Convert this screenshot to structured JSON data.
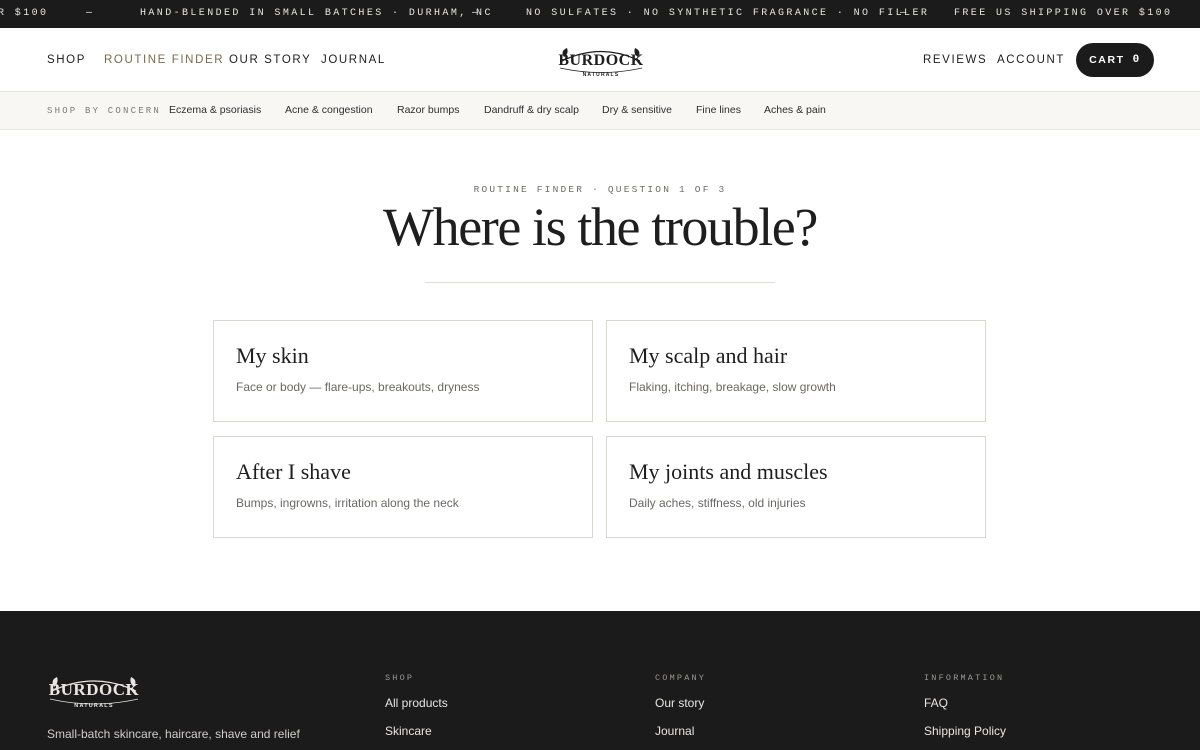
{
  "ticker": {
    "items": [
      "R $100",
      "—",
      "HAND-BLENDED IN SMALL BATCHES · DURHAM, NC",
      "—",
      "NO SULFATES · NO SYNTHETIC FRAGRANCE · NO FILLER",
      "—",
      "FREE US SHIPPING OVER $100"
    ]
  },
  "header": {
    "nav_left": [
      "SHOP",
      "ROUTINE FINDER",
      "OUR STORY",
      "JOURNAL"
    ],
    "logo": {
      "wordmark": "BURDOCK",
      "sub": "NATURALS"
    },
    "nav_right": [
      "REVIEWS",
      "ACCOUNT"
    ],
    "cart": {
      "label": "CART",
      "count": "0"
    },
    "accent_color": "#7a6a4a"
  },
  "concern_bar": {
    "label": "SHOP BY CONCERN",
    "items": [
      "Eczema & psoriasis",
      "Acne & congestion",
      "Razor bumps",
      "Dandruff & dry scalp",
      "Dry & sensitive",
      "Fine lines",
      "Aches & pain"
    ]
  },
  "finder": {
    "eyebrow": "ROUTINE FINDER · QUESTION 1 OF 3",
    "question": "Where is the trouble?",
    "options": [
      {
        "title": "My skin",
        "desc": "Face or body — flare-ups, breakouts, dryness"
      },
      {
        "title": "My scalp and hair",
        "desc": "Flaking, itching, breakage, slow growth"
      },
      {
        "title": "After I shave",
        "desc": "Bumps, ingrowns, irritation along the neck"
      },
      {
        "title": "My joints and muscles",
        "desc": "Daily aches, stiffness, old injuries"
      }
    ]
  },
  "footer": {
    "tagline": "Small-batch skincare, haircare, shave and relief",
    "columns": [
      {
        "heading": "SHOP",
        "links": [
          "All products",
          "Skincare"
        ]
      },
      {
        "heading": "COMPANY",
        "links": [
          "Our story",
          "Journal"
        ]
      },
      {
        "heading": "INFORMATION",
        "links": [
          "FAQ",
          "Shipping Policy"
        ]
      }
    ]
  }
}
